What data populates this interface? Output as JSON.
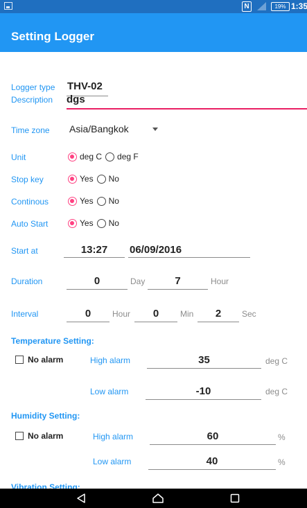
{
  "status_bar": {
    "nfc_icon": "nfc-icon",
    "signal_icon": "signal-icon",
    "battery": "19%",
    "time": "1:35"
  },
  "app_bar": {
    "title": "Setting Logger"
  },
  "form": {
    "logger_type": {
      "label": "Logger type",
      "value": "THV-02"
    },
    "description": {
      "label": "Description",
      "value": "dgs"
    },
    "time_zone": {
      "label": "Time zone",
      "value": "Asia/Bangkok"
    },
    "unit": {
      "label": "Unit",
      "options": [
        "deg C",
        "deg F"
      ],
      "selected": "deg C"
    },
    "stop_key": {
      "label": "Stop key",
      "options": [
        "Yes",
        "No"
      ],
      "selected": "Yes"
    },
    "continous": {
      "label": "Continous",
      "options": [
        "Yes",
        "No"
      ],
      "selected": "Yes"
    },
    "auto_start": {
      "label": "Auto Start",
      "options": [
        "Yes",
        "No"
      ],
      "selected": "Yes"
    },
    "start_at": {
      "label": "Start at",
      "time": "13:27",
      "date": "06/09/2016"
    },
    "duration": {
      "label": "Duration",
      "day": "0",
      "day_unit": "Day",
      "hour": "7",
      "hour_unit": "Hour"
    },
    "interval": {
      "label": "Interval",
      "hour": "0",
      "hour_unit": "Hour",
      "min": "0",
      "min_unit": "Min",
      "sec": "2",
      "sec_unit": "Sec"
    }
  },
  "temperature": {
    "title": "Temperature Setting:",
    "no_alarm_label": "No alarm",
    "no_alarm_checked": false,
    "high_label": "High alarm",
    "high_value": "35",
    "low_label": "Low alarm",
    "low_value": "-10",
    "unit": "deg C"
  },
  "humidity": {
    "title": "Humidity Setting:",
    "no_alarm_label": "No alarm",
    "no_alarm_checked": false,
    "high_label": "High alarm",
    "high_value": "60",
    "low_label": "Low alarm",
    "low_value": "40",
    "unit": "%"
  },
  "vibration": {
    "title": "Vibration Setting:"
  },
  "nav_bar": {
    "back_icon": "back-icon",
    "home_icon": "home-icon",
    "recents_icon": "recents-icon"
  },
  "colors": {
    "accent": "#2196f3",
    "radio_selected": "#ff4081",
    "status_bar": "#1f6fc0",
    "focus_underline": "#e91e63"
  }
}
